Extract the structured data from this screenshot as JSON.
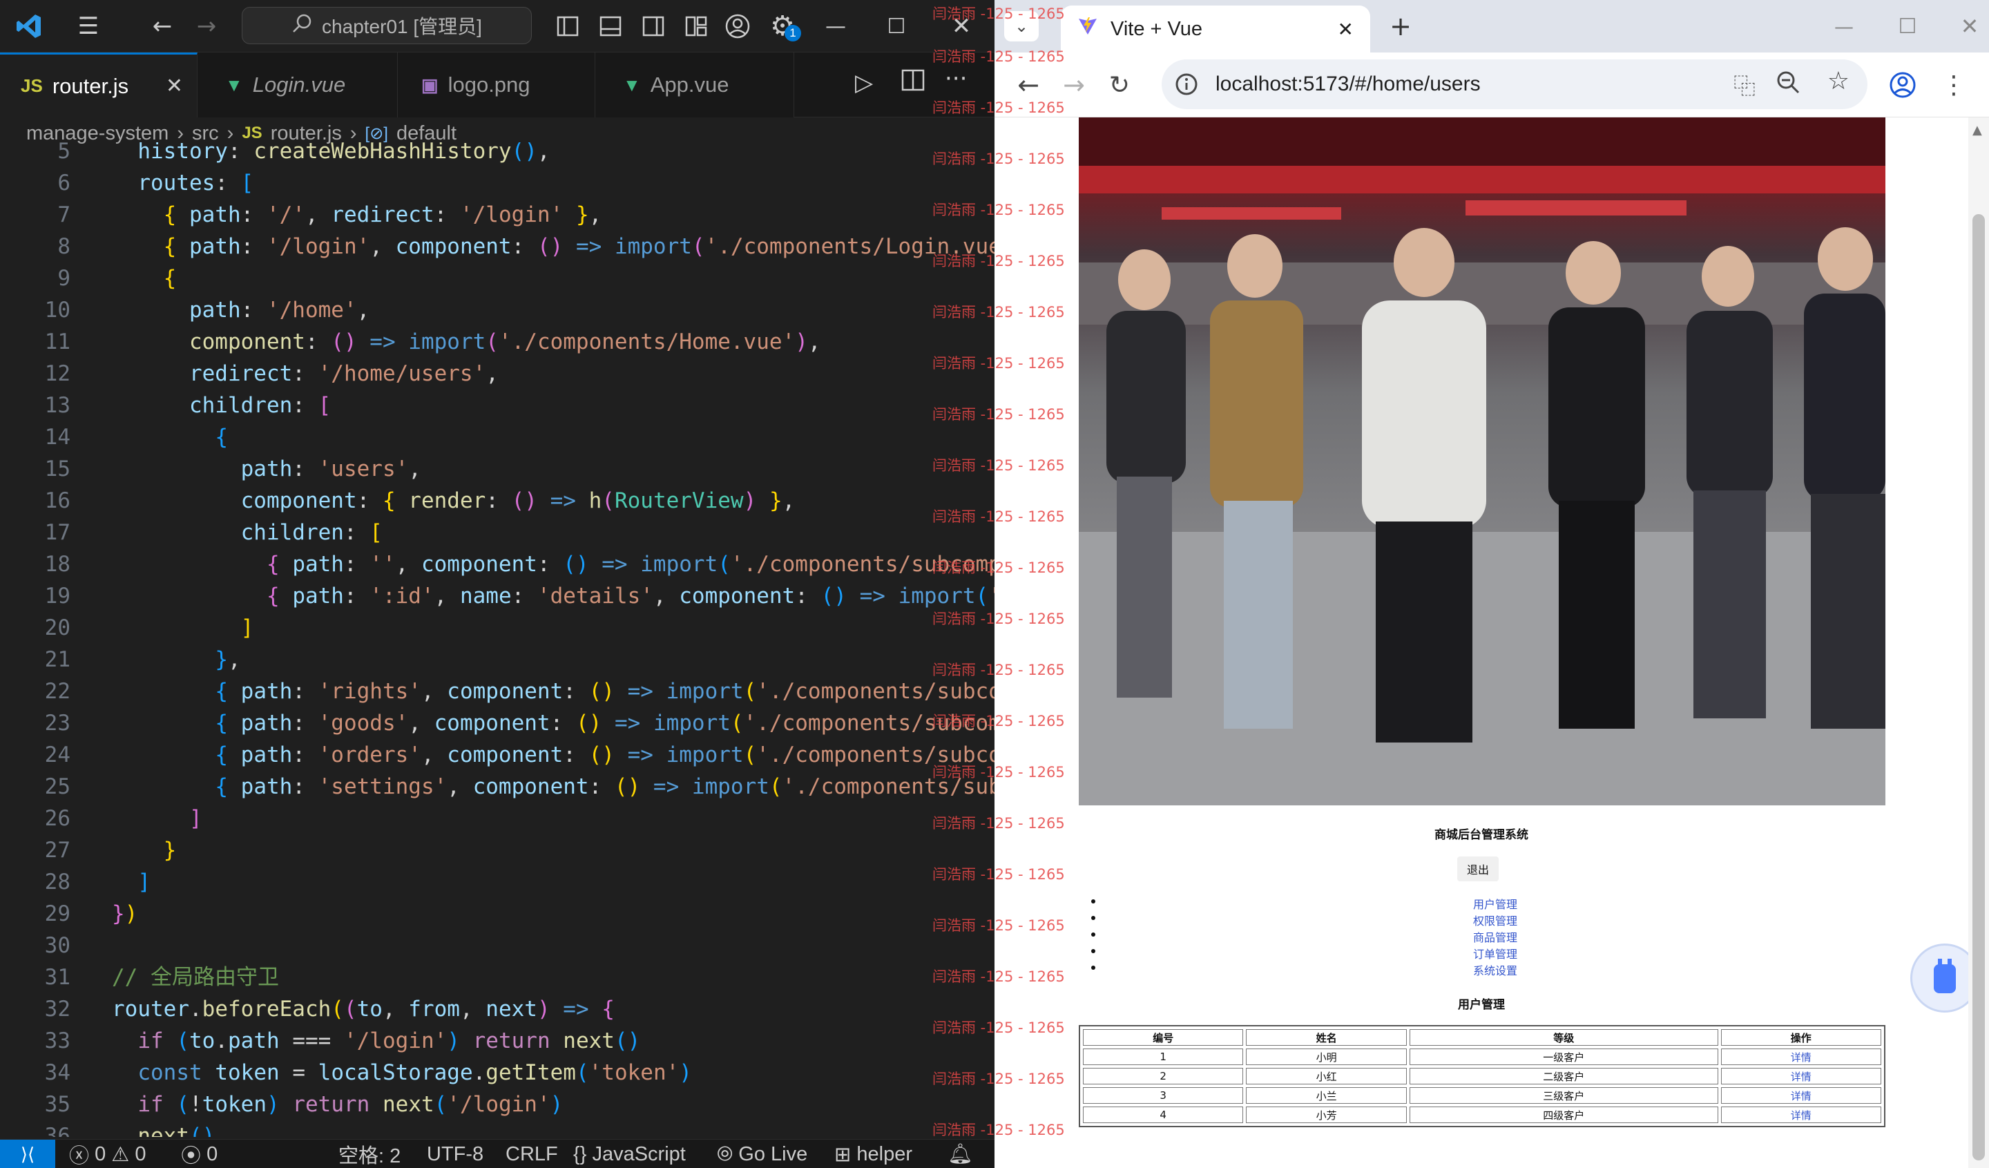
{
  "vscode": {
    "search_text": "chapter01 [管理员]",
    "settings_badge": "1",
    "tabs": [
      {
        "label": "router.js",
        "icon": "JS"
      },
      {
        "label": "Login.vue",
        "icon": "V"
      },
      {
        "label": "logo.png",
        "icon": "img"
      },
      {
        "label": "App.vue",
        "icon": "V"
      }
    ],
    "breadcrumb": [
      "manage-system",
      "src",
      "router.js",
      "default"
    ],
    "breadcrumb_js": "JS",
    "line_numbers": [
      "5",
      "6",
      "7",
      "8",
      "9",
      "10",
      "11",
      "12",
      "13",
      "14",
      "15",
      "16",
      "17",
      "18",
      "19",
      "20",
      "21",
      "22",
      "23",
      "24",
      "25",
      "26",
      "27",
      "28",
      "29",
      "30",
      "31",
      "32",
      "33",
      "34",
      "35",
      "36"
    ],
    "watermark": "闫浩雨 -125 - 1265",
    "status": {
      "errors": "0",
      "warnings": "0",
      "ports": "0",
      "spaces": "空格: 2",
      "encoding": "UTF-8",
      "eol": "CRLF",
      "language": "JavaScript",
      "golive": "Go Live",
      "helper": "helper"
    }
  },
  "browser": {
    "tab_title": "Vite + Vue",
    "url": "localhost:5173/#/home/users",
    "app_title": "商城后台管理系统",
    "logout_label": "退出",
    "nav_items": [
      "用户管理",
      "权限管理",
      "商品管理",
      "订单管理",
      "系统设置"
    ],
    "section_title": "用户管理",
    "table": {
      "headers": [
        "编号",
        "姓名",
        "等级",
        "操作"
      ],
      "rows": [
        [
          "1",
          "小明",
          "一级客户",
          "详情"
        ],
        [
          "2",
          "小红",
          "二级客户",
          "详情"
        ],
        [
          "3",
          "小兰",
          "三级客户",
          "详情"
        ],
        [
          "4",
          "小芳",
          "四级客户",
          "详情"
        ]
      ]
    }
  },
  "colors": {
    "vscode_bg": "#1f1f1f",
    "accent": "#0078d4",
    "link": "#3355cc",
    "watermark": "#e64646"
  }
}
